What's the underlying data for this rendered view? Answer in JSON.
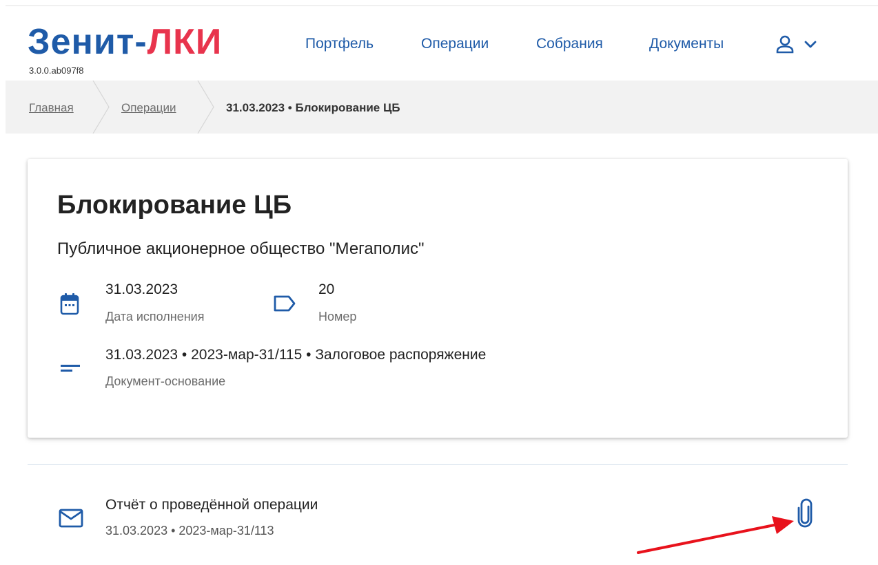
{
  "header": {
    "logo_part1": "Зенит-",
    "logo_part2": "ЛКИ",
    "version": "3.0.0.ab097f8",
    "nav": [
      {
        "label": "Портфель"
      },
      {
        "label": "Операции"
      },
      {
        "label": "Собрания"
      },
      {
        "label": "Документы"
      }
    ],
    "user_icon": "user-icon",
    "dropdown_icon": "chevron-down-icon"
  },
  "breadcrumb": {
    "items": [
      {
        "label": "Главная"
      },
      {
        "label": "Операции"
      },
      {
        "label": "31.03.2023 • Блокирование ЦБ"
      }
    ]
  },
  "operation": {
    "title": "Блокирование ЦБ",
    "issuer": "Публичное акционерное общество \"Мегаполис\"",
    "execution_date": {
      "value": "31.03.2023",
      "label": "Дата исполнения",
      "icon": "calendar-icon"
    },
    "number": {
      "value": "20",
      "label": "Номер",
      "icon": "tag-icon"
    },
    "basis_document": {
      "value": "31.03.2023 • 2023-мар-31/115 • Залоговое распоряжение",
      "label": "Документ-основание",
      "icon": "notes-icon"
    }
  },
  "report": {
    "title": "Отчёт о проведённой операции",
    "meta": "31.03.2023 • 2023-мар-31/113",
    "icon": "mail-icon",
    "attachment_icon": "paperclip-icon"
  },
  "colors": {
    "brand_blue": "#1f5ba8",
    "brand_red": "#e8344d",
    "annotation_arrow": "#e8121c"
  }
}
